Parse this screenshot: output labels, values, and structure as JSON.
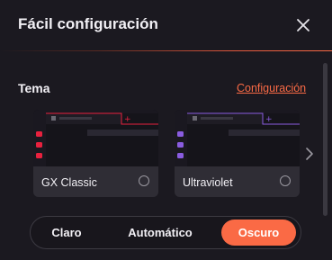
{
  "header": {
    "title": "Fácil configuración",
    "close_icon": "close-icon"
  },
  "theme": {
    "section_title": "Tema",
    "settings_link": "Configuración",
    "cards": [
      {
        "label": "GX Classic",
        "accent": "#e8213e",
        "selected": false
      },
      {
        "label": "Ultraviolet",
        "accent": "#8a5ce0",
        "selected": false
      }
    ],
    "next_icon": "chevron-right-icon"
  },
  "mode": {
    "options": [
      "Claro",
      "Automático",
      "Oscuro"
    ],
    "selected": "Oscuro",
    "accent": "#fa6a45"
  }
}
